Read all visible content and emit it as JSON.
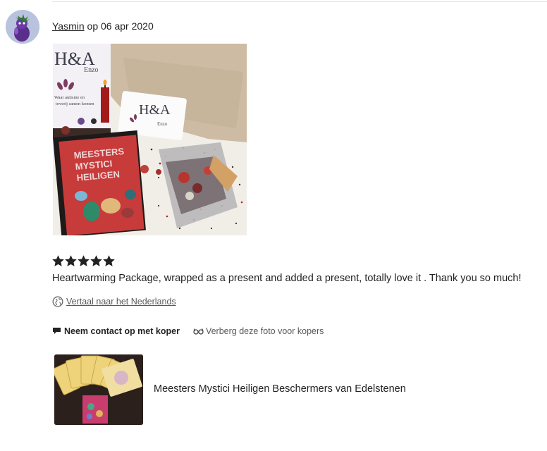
{
  "review": {
    "reviewer_name": "Yasmin",
    "date_text": "op 06 apr 2020",
    "rating": 5,
    "rating_max": 5,
    "text": "Heartwarming Package, wrapped as a present and added a present, totally love it . Thank you so much!",
    "translate_label": "Vertaal naar het Nederlands"
  },
  "photo": {
    "sign_logo": "H&A",
    "sign_name": "Enzo",
    "sign_line_1": "Waar autisme en",
    "sign_line_2": "toverij samen komen",
    "card_logo": "H&A",
    "card_name": "Enzo",
    "book_title_1": "MEESTERS",
    "book_title_2": "MYSTICI",
    "book_title_3": "HEILIGEN"
  },
  "actions": {
    "contact_label": "Neem contact op met koper",
    "hide_photo_label": "Verberg deze foto voor kopers"
  },
  "product": {
    "title": "Meesters Mystici Heiligen Beschermers van Edelstenen"
  },
  "colors": {
    "text": "#222222",
    "muted": "#595959",
    "star": "#222222",
    "divider": "#e1e3df"
  },
  "icons": {
    "star": "star-icon",
    "translate": "globe-icon",
    "contact": "message-flag-icon",
    "hide": "glasses-icon"
  }
}
